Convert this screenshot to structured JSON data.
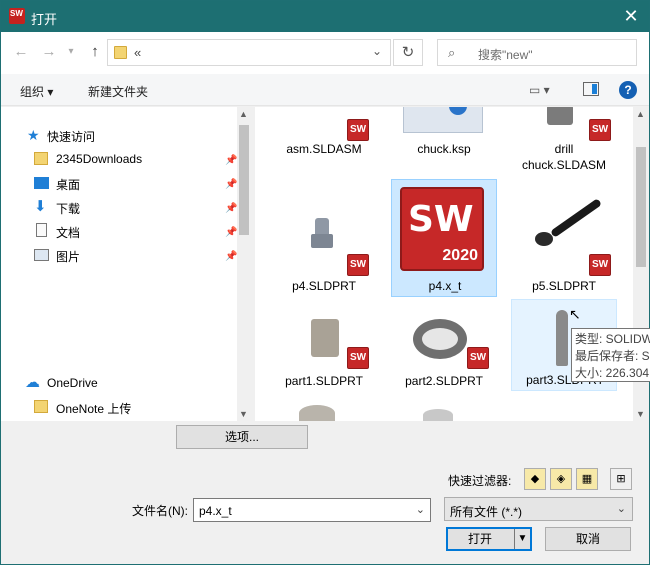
{
  "window": {
    "title": "打开"
  },
  "navbar": {
    "address_crumb": "«",
    "search_placeholder": "搜索\"new\""
  },
  "toolbar": {
    "organize": "组织 ▾",
    "new_folder": "新建文件夹"
  },
  "sidebar": {
    "quick_access": "快速访问",
    "items": [
      {
        "label": "2345Downloads",
        "pinned": true
      },
      {
        "label": "桌面",
        "pinned": true
      },
      {
        "label": "下载",
        "pinned": true
      },
      {
        "label": "文档",
        "pinned": true
      },
      {
        "label": "图片",
        "pinned": true
      }
    ],
    "onedrive": "OneDrive",
    "onenote": "OneNote 上传"
  },
  "files": [
    {
      "name": "asm.SLDASM"
    },
    {
      "name": "chuck.ksp"
    },
    {
      "name": "drill chuck.SLDASM"
    },
    {
      "name": "p4.SLDPRT"
    },
    {
      "name": "p4.x_t",
      "icon_text": "SW",
      "icon_year": "2020"
    },
    {
      "name": "p5.SLDPRT"
    },
    {
      "name": "part1.SLDPRT"
    },
    {
      "name": "part2.SLDPRT"
    },
    {
      "name": "part3.SLDPRT"
    }
  ],
  "tooltip": {
    "type": "类型: SOLIDW",
    "saved_by": "最后保存者: SI",
    "size": "大小: 226.304"
  },
  "bottom": {
    "options_button": "选项...",
    "quick_filter_label": "快速过滤器:",
    "filename_label": "文件名(N):",
    "filename_value": "p4.x_t",
    "filetype_value": "所有文件 (*.*)",
    "open_button": "打开",
    "cancel_button": "取消"
  },
  "colors": {
    "titlebar": "#1d6f72",
    "selection": "#cce8ff",
    "sw_red": "#c62828"
  }
}
